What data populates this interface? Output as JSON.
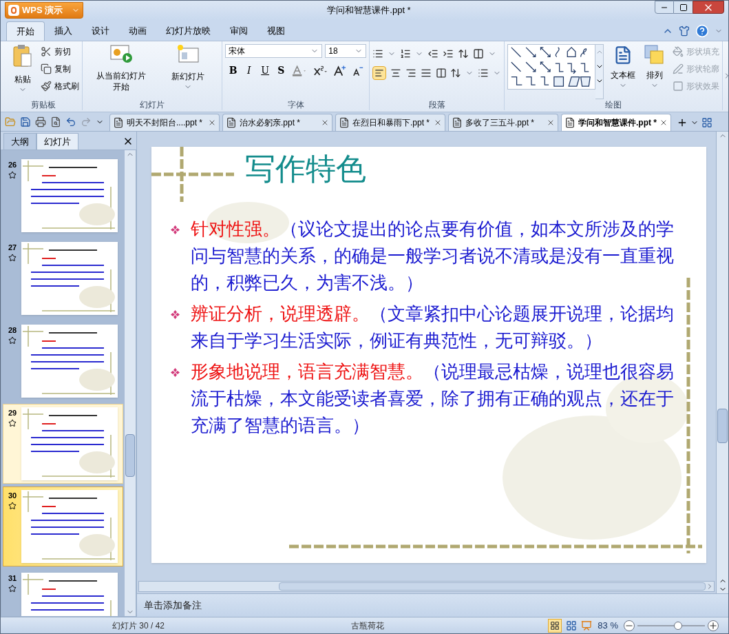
{
  "app_button": {
    "label": "WPS 演示"
  },
  "window": {
    "title": "学问和智慧课件.ppt *"
  },
  "menu_tabs": [
    {
      "label": "开始",
      "selected": true
    },
    {
      "label": "插入",
      "selected": false
    },
    {
      "label": "设计",
      "selected": false
    },
    {
      "label": "动画",
      "selected": false
    },
    {
      "label": "幻灯片放映",
      "selected": false
    },
    {
      "label": "审阅",
      "selected": false
    },
    {
      "label": "视图",
      "selected": false
    }
  ],
  "ribbon": {
    "clipboard": {
      "title": "剪贴板",
      "paste": "粘贴",
      "items": [
        "剪切",
        "复制",
        "格式刷"
      ]
    },
    "slides": {
      "title": "幻灯片",
      "from_current": [
        "从当前幻灯片",
        "开始"
      ],
      "new_slide": "新幻灯片"
    },
    "font": {
      "title": "字体",
      "font_name": "宋体",
      "font_size": "18",
      "format_buttons": [
        {
          "label": "B",
          "kind": "bold"
        },
        {
          "label": "I",
          "kind": "italic"
        },
        {
          "label": "U",
          "kind": "underline"
        },
        {
          "label": "S",
          "kind": "shadow"
        }
      ]
    },
    "paragraph": {
      "title": "段落"
    },
    "drawing": {
      "title": "绘图",
      "text_box": "文本框",
      "arrange": "排列",
      "shape_options": [
        {
          "label": "形状填充",
          "disabled": true
        },
        {
          "label": "形状轮廓",
          "disabled": true
        },
        {
          "label": "形状效果",
          "disabled": true
        }
      ]
    }
  },
  "doc_tabs": [
    {
      "label": "明天不封阳台....ppt *",
      "selected": false
    },
    {
      "label": "治水必躬亲.ppt *",
      "selected": false
    },
    {
      "label": "在烈日和暴雨下.ppt *",
      "selected": false
    },
    {
      "label": "多收了三五斗.ppt *",
      "selected": false
    },
    {
      "label": "学问和智慧课件.ppt *",
      "selected": true
    }
  ],
  "side_panel": {
    "tabs": [
      {
        "label": "大纲",
        "selected": false
      },
      {
        "label": "幻灯片",
        "selected": true
      }
    ],
    "thumbnails": [
      {
        "number": "26",
        "selected": false,
        "highlighted": false
      },
      {
        "number": "27",
        "selected": false,
        "highlighted": false
      },
      {
        "number": "28",
        "selected": false,
        "highlighted": false
      },
      {
        "number": "29",
        "selected": false,
        "highlighted": true
      },
      {
        "number": "30",
        "selected": true,
        "highlighted": false
      },
      {
        "number": "31",
        "selected": false,
        "highlighted": false
      }
    ]
  },
  "slide": {
    "title": "写作特色",
    "bullets": [
      {
        "heading": "针对性强。",
        "body": "（议论文提出的论点要有价值，如本文所涉及的学问与智慧的关系，的确是一般学习者说不清或是没有一直重视的，积弊已久，为害不浅。）"
      },
      {
        "heading": "辨证分析，说理透辟。",
        "body": "（文章紧扣中心论题展开说理，论据均来自于学习生活实际，例证有典范性，无可辩驳。）"
      },
      {
        "heading": "形象地说理，语言充满智慧。",
        "body": "（说理最忌枯燥，说理也很容易流于枯燥，本文能受读者喜爱，除了拥有正确的观点，还在于充满了智慧的语言。）"
      }
    ]
  },
  "notes": {
    "placeholder": "单击添加备注"
  },
  "status_bar": {
    "slide_count": "幻灯片 30 / 42",
    "theme": "古瓶荷花",
    "zoom": "83 %",
    "zoom_slider": {
      "level": 0.6
    }
  }
}
